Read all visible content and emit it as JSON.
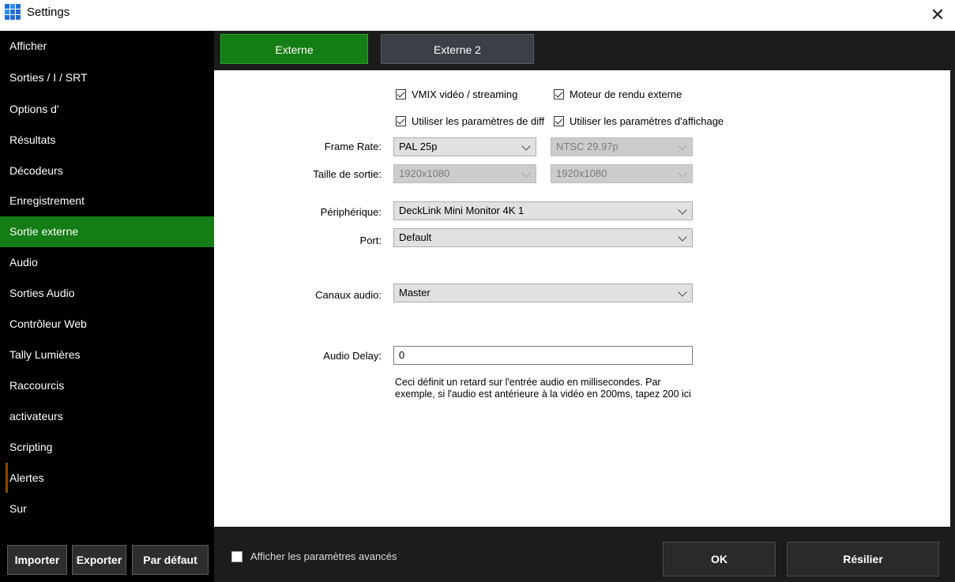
{
  "window": {
    "title": "Settings",
    "close_glyph": "✕"
  },
  "sidebar": {
    "items": [
      {
        "label": "Afficher"
      },
      {
        "label": "Sorties / I / SRT"
      },
      {
        "label": "Options d'"
      },
      {
        "label": "Résultats"
      },
      {
        "label": "Décodeurs"
      },
      {
        "label": "Enregistrement"
      },
      {
        "label": "Sortie externe",
        "active": true
      },
      {
        "label": "Audio"
      },
      {
        "label": "Sorties Audio"
      },
      {
        "label": "Contrôleur Web"
      },
      {
        "label": "Tally Lumières"
      },
      {
        "label": "Raccourcis"
      },
      {
        "label": "activateurs"
      },
      {
        "label": "Scripting"
      },
      {
        "label": "Alertes"
      },
      {
        "label": "Sur"
      }
    ],
    "buttons": {
      "import": "Importer",
      "export": "Exporter",
      "default": "Par défaut"
    }
  },
  "tabs": [
    {
      "label": "Externe",
      "active": true
    },
    {
      "label": "Externe 2",
      "active": false
    }
  ],
  "form": {
    "checkboxes": {
      "vmix_video": {
        "label": "VMIX vidéo / streaming",
        "checked": true
      },
      "external_renderer": {
        "label": "Moteur de rendu externe",
        "checked": true
      },
      "use_diff_params": {
        "label": "Utiliser les paramètres de diff",
        "checked": true
      },
      "use_display_params": {
        "label": "Utiliser les paramètres d'affichage",
        "checked": true
      }
    },
    "frame_rate": {
      "label": "Frame Rate:",
      "value1": "PAL 25p",
      "value2": "NTSC 29.97p"
    },
    "output_size": {
      "label": "Taille de sortie:",
      "value1": "1920x1080",
      "value2": "1920x1080"
    },
    "device": {
      "label": "Périphérique:",
      "value": "DeckLink Mini Monitor 4K 1"
    },
    "port": {
      "label": "Port:",
      "value": "Default"
    },
    "audio_channels": {
      "label": "Canaux audio:",
      "value": "Master"
    },
    "audio_delay": {
      "label": "Audio Delay:",
      "value": "0",
      "help_line1": "Ceci définit un retard sur l'entrée audio en millisecondes. Par",
      "help_line2": "exemple, si l'audio est antérieure à la vidéo en 200ms, tapez 200 ici"
    }
  },
  "footer": {
    "advanced_label": "Afficher les paramètres avancés",
    "advanced_checked": false,
    "ok_label": "OK",
    "cancel_label": "Résilier"
  },
  "colors": {
    "accent_green": "#157d15",
    "sidebar_bg": "#000000",
    "panel_dark": "#1c1c1c",
    "app_icon_blue": "#1f6fd6"
  }
}
